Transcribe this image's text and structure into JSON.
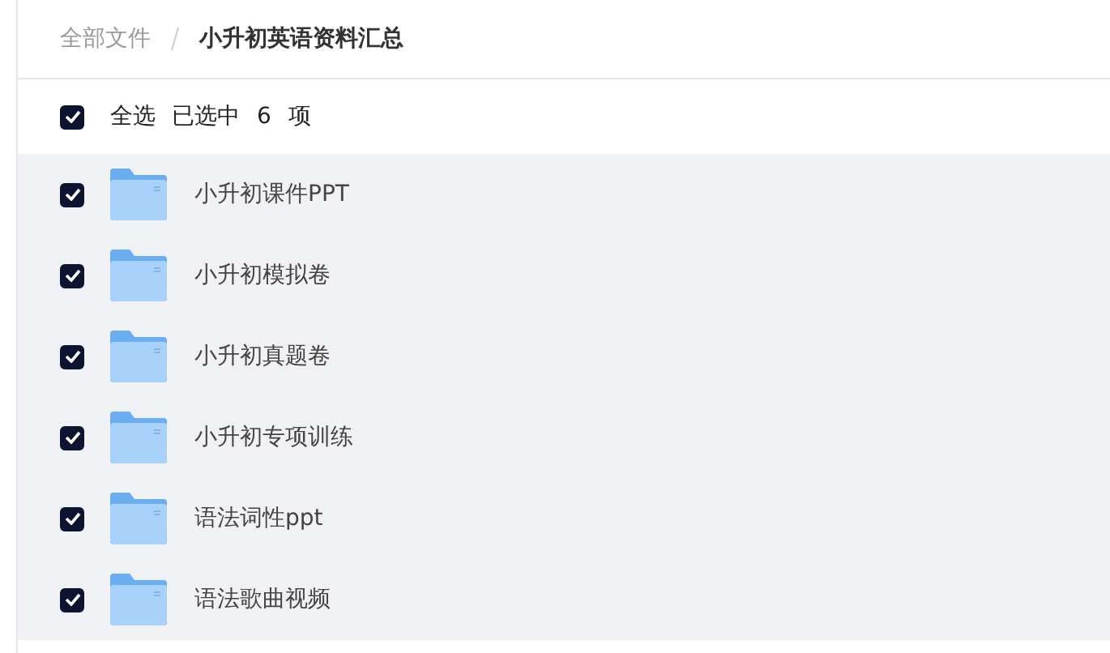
{
  "breadcrumb": [
    {
      "label": "全部文件",
      "current": false
    },
    {
      "label": "小升初英语资料汇总",
      "current": true
    }
  ],
  "select_all": {
    "label": "全选",
    "checked": true,
    "count_text": "已选中 6 项"
  },
  "files": [
    {
      "name": "小升初课件PPT",
      "checked": true,
      "selected": true
    },
    {
      "name": "小升初模拟卷",
      "checked": true,
      "selected": true
    },
    {
      "name": "小升初真题卷",
      "checked": true,
      "selected": true
    },
    {
      "name": "小升初专项训练",
      "checked": true,
      "selected": true
    },
    {
      "name": "语法词性ppt",
      "checked": true,
      "selected": true
    },
    {
      "name": "语法歌曲视频",
      "checked": true,
      "selected": true
    }
  ]
}
